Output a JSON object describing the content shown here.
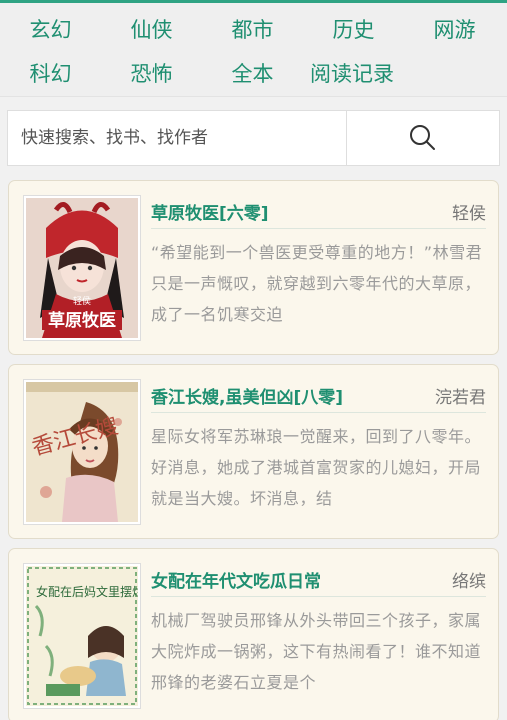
{
  "categories": {
    "row1": [
      "玄幻",
      "仙侠",
      "都市",
      "历史",
      "网游"
    ],
    "row2": [
      "科幻",
      "恐怖",
      "全本",
      "阅读记录"
    ]
  },
  "search": {
    "placeholder": "快速搜索、找书、找作者",
    "icon": "search-icon"
  },
  "books": [
    {
      "title": "草原牧医[六零]",
      "author": "轻侯",
      "description": "“希望能到一个兽医更受尊重的地方！”林雪君只是一声慨叹，就穿越到六零年代的大草原，成了一名饥寒交迫",
      "cover_text": "草原牧医",
      "cover_sub": "轻侯"
    },
    {
      "title": "香江长嫂,虽美但凶[八零]",
      "author": "浣若君",
      "description": "星际女将军苏琳琅一觉醒来，回到了八零年。好消息，她成了港城首富贺家的儿媳妇，开局就是当大嫂。坏消息，结",
      "cover_text": "香江长嫂"
    },
    {
      "title": "女配在年代文吃瓜日常",
      "author": "络缤",
      "description": "机械厂驾驶员邢锋从外头带回三个孩子，家属大院炸成一锅粥，这下有热闹看了！谁不知道邢锋的老婆石立夏是个",
      "cover_text": "女配在后妈文里摆烂吃瓜"
    }
  ],
  "colors": {
    "accent": "#1f8f71",
    "card_bg": "#fbf7ec",
    "topline": "#2fa383"
  }
}
